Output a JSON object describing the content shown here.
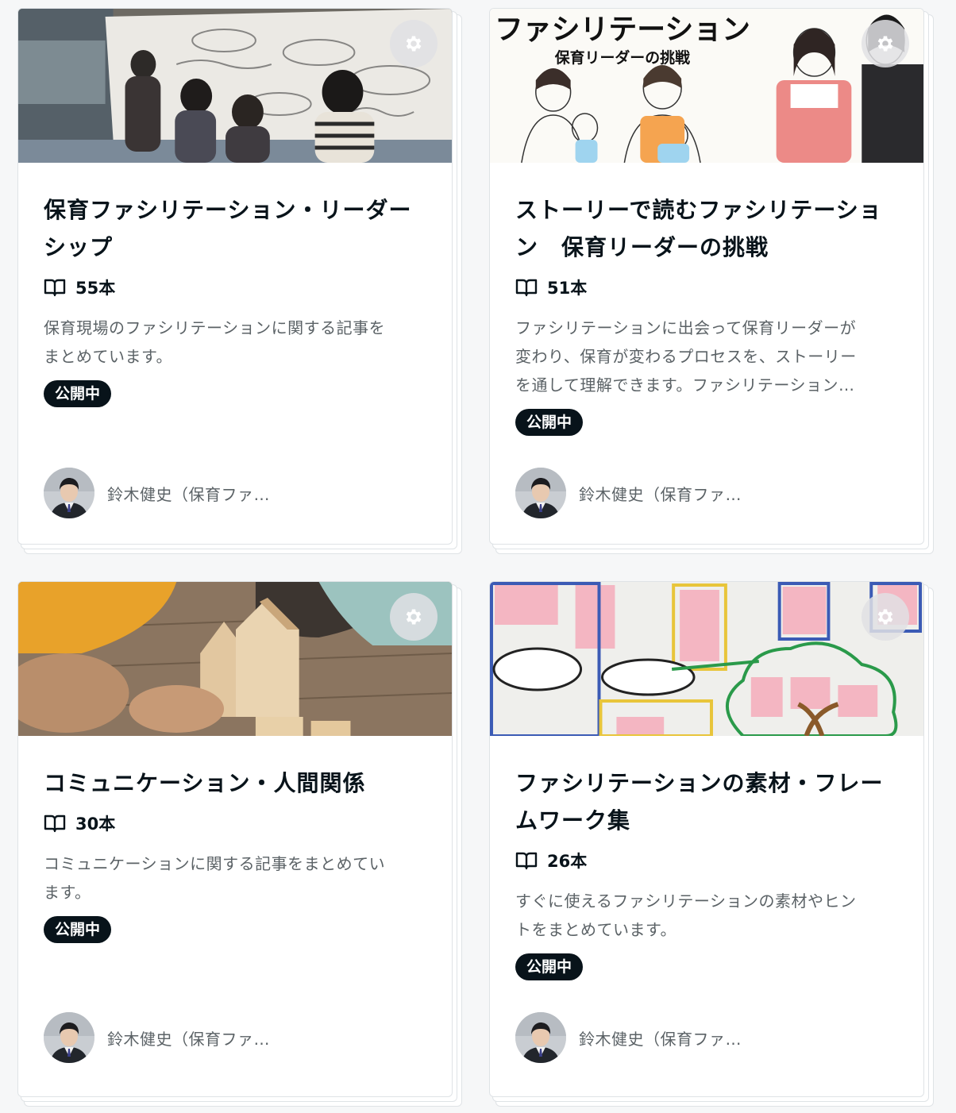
{
  "cards": [
    {
      "title_line1": "保育ファシリテーション・リーダー",
      "title_line2": "シップ",
      "count": "55本",
      "desc_line1": "保育現場のファシリテーションに関する記事を",
      "desc_line2": "まとめています。",
      "desc_line3": "",
      "status": "公開中",
      "author": "鈴木健史（保育ファ…",
      "image": "whiteboard-children-photo"
    },
    {
      "title_line1": "ストーリーで読むファシリテーショ",
      "title_line2": "ン　保育リーダーの挑戦",
      "count": "51本",
      "desc_line1": "ファシリテーションに出会って保育リーダーが",
      "desc_line2": "変わり、保育が変わるプロセスを、ストーリー",
      "desc_line3": "を通して理解できます。ファシリテーション…",
      "status": "公開中",
      "author": "鈴木健史（保育ファ…",
      "image": "manga-illustration",
      "image_text_main": "ファシリテーション",
      "image_text_sub": "保育リーダーの挑戦"
    },
    {
      "title_line1": "コミュニケーション・人間関係",
      "title_line2": "",
      "count": "30本",
      "desc_line1": "コミュニケーションに関する記事をまとめてい",
      "desc_line2": "ます。",
      "desc_line3": "",
      "status": "公開中",
      "author": "鈴木健史（保育ファ…",
      "image": "wooden-blocks-photo"
    },
    {
      "title_line1": "ファシリテーションの素材・フレー",
      "title_line2": "ムワーク集",
      "count": "26本",
      "desc_line1": "すぐに使えるファシリテーションの素材やヒン",
      "desc_line2": "トをまとめています。",
      "desc_line3": "",
      "status": "公開中",
      "author": "鈴木健史（保育ファ…",
      "image": "sticky-notes-board-photo"
    }
  ],
  "icons": {
    "gear": "gear-icon",
    "book": "book-icon"
  },
  "colors": {
    "badge_bg": "#08131a",
    "page_bg": "#f6f7f8",
    "muted_text": "#5b6266"
  }
}
